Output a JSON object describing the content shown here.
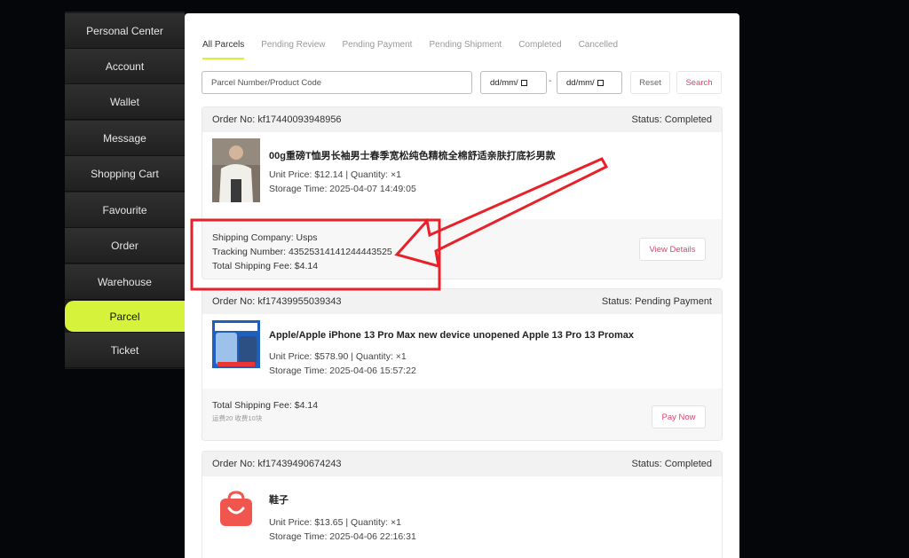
{
  "sidebar": {
    "items": [
      {
        "label": "Personal Center"
      },
      {
        "label": "Account"
      },
      {
        "label": "Wallet"
      },
      {
        "label": "Message"
      },
      {
        "label": "Shopping Cart"
      },
      {
        "label": "Favourite"
      },
      {
        "label": "Order"
      },
      {
        "label": "Warehouse"
      },
      {
        "label": "Parcel"
      },
      {
        "label": "Ticket"
      }
    ],
    "active": "Parcel"
  },
  "tabs": [
    {
      "label": "All Parcels"
    },
    {
      "label": "Pending Review"
    },
    {
      "label": "Pending Payment"
    },
    {
      "label": "Pending Shipment"
    },
    {
      "label": "Completed"
    },
    {
      "label": "Cancelled"
    }
  ],
  "filters": {
    "search_placeholder": "Parcel Number/Product Code",
    "date_from": "dd/mm/",
    "date_separator": "-",
    "date_to": "dd/mm/",
    "reset_label": "Reset",
    "search_label": "Search"
  },
  "orders": [
    {
      "order_no": "Order No: kf17440093948956",
      "status": "Status: Completed",
      "product_title": "00g重磅T恤男长袖男士春季宽松纯色精梳全棉舒适亲肤打底衫男款",
      "price_qty": "Unit Price: $12.14 | Quantity: ×1",
      "storage_time": "Storage Time: 2025-04-07 14:49:05",
      "shipping_company": "Shipping Company: Usps",
      "tracking_number": "Tracking Number: 43525314141244443525",
      "shipping_fee": "Total Shipping Fee: $4.14",
      "action": "View Details"
    },
    {
      "order_no": "Order No: kf17439955039343",
      "status": "Status: Pending Payment",
      "product_title": "Apple/Apple iPhone 13 Pro Max new device unopened Apple 13 Pro 13 Promax",
      "price_qty": "Unit Price: $578.90 | Quantity: ×1",
      "storage_time": "Storage Time: 2025-04-06 15:57:22",
      "shipping_fee": "Total Shipping Fee: $4.14",
      "fee_note": "运费20 收费10块",
      "action": "Pay Now"
    },
    {
      "order_no": "Order No: kf17439490674243",
      "status": "Status: Completed",
      "product_title": "鞋子",
      "price_qty": "Unit Price: $13.65 | Quantity: ×1",
      "storage_time": "Storage Time: 2025-04-06 22:16:31"
    }
  ],
  "colors": {
    "accent": "#d7f23b",
    "action_text": "#e0456a",
    "annotation_red": "#e8202a"
  }
}
